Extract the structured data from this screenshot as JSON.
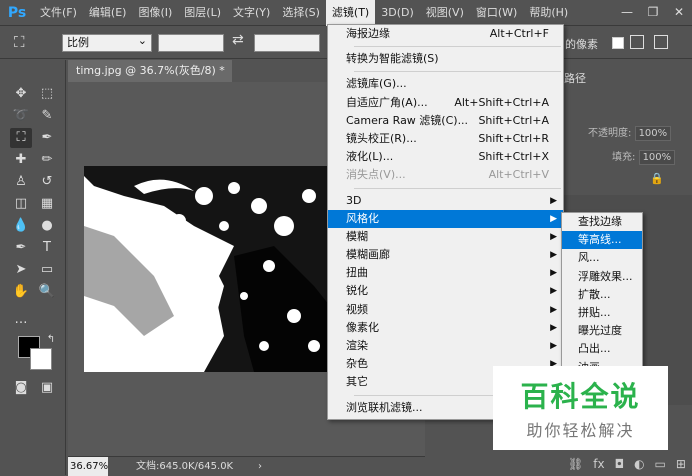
{
  "app": {
    "logo": "Ps"
  },
  "menubar": {
    "items": [
      "文件(F)",
      "编辑(E)",
      "图像(I)",
      "图层(L)",
      "文字(Y)",
      "选择(S)",
      "滤镜(T)",
      "3D(D)",
      "视图(V)",
      "窗口(W)",
      "帮助(H)"
    ],
    "active_index": 6
  },
  "window_controls": {
    "minimize": "—",
    "restore": "❐",
    "close": "✕"
  },
  "options_bar": {
    "ratio_select": "比例",
    "swap_icon": "⇄",
    "trailing_text": "的像素"
  },
  "document": {
    "tab_title": "timg.jpg @ 36.7%(灰色/8) *",
    "close": "×"
  },
  "statusbar": {
    "zoom": "36.67%",
    "doc_info": "文档:645.0K/645.0K",
    "arrow": "›"
  },
  "right_panel": {
    "tab_label": "路径",
    "opacity_label": "不透明度:",
    "opacity_value": "100%",
    "fill_label": "填充:",
    "fill_value": "100%"
  },
  "filter_menu": {
    "groups": [
      [
        {
          "label": "海报边缘",
          "shortcut": "Alt+Ctrl+F"
        }
      ],
      [
        {
          "label": "转换为智能滤镜(S)",
          "shortcut": ""
        }
      ],
      [
        {
          "label": "滤镜库(G)...",
          "shortcut": ""
        },
        {
          "label": "自适应广角(A)...",
          "shortcut": "Alt+Shift+Ctrl+A"
        },
        {
          "label": "Camera Raw 滤镜(C)...",
          "shortcut": "Shift+Ctrl+A"
        },
        {
          "label": "镜头校正(R)...",
          "shortcut": "Shift+Ctrl+R"
        },
        {
          "label": "液化(L)...",
          "shortcut": "Shift+Ctrl+X"
        },
        {
          "label": "消失点(V)...",
          "shortcut": "Alt+Ctrl+V",
          "disabled": true
        }
      ],
      [
        {
          "label": "3D",
          "submenu": true
        },
        {
          "label": "风格化",
          "submenu": true,
          "highlighted": true
        },
        {
          "label": "模糊",
          "submenu": true
        },
        {
          "label": "模糊画廊",
          "submenu": true
        },
        {
          "label": "扭曲",
          "submenu": true
        },
        {
          "label": "锐化",
          "submenu": true
        },
        {
          "label": "视频",
          "submenu": true
        },
        {
          "label": "像素化",
          "submenu": true
        },
        {
          "label": "渲染",
          "submenu": true
        },
        {
          "label": "杂色",
          "submenu": true
        },
        {
          "label": "其它",
          "submenu": true
        }
      ],
      [
        {
          "label": "浏览联机滤镜...",
          "shortcut": ""
        }
      ]
    ]
  },
  "stylize_submenu": {
    "items": [
      "查找边缘",
      "等高线...",
      "风...",
      "浮雕效果...",
      "扩散...",
      "拼贴...",
      "曝光过度",
      "凸出...",
      "油画..."
    ],
    "highlighted_index": 1
  },
  "watermark": {
    "title": "百科全说",
    "subtitle": "助你轻松解决"
  }
}
